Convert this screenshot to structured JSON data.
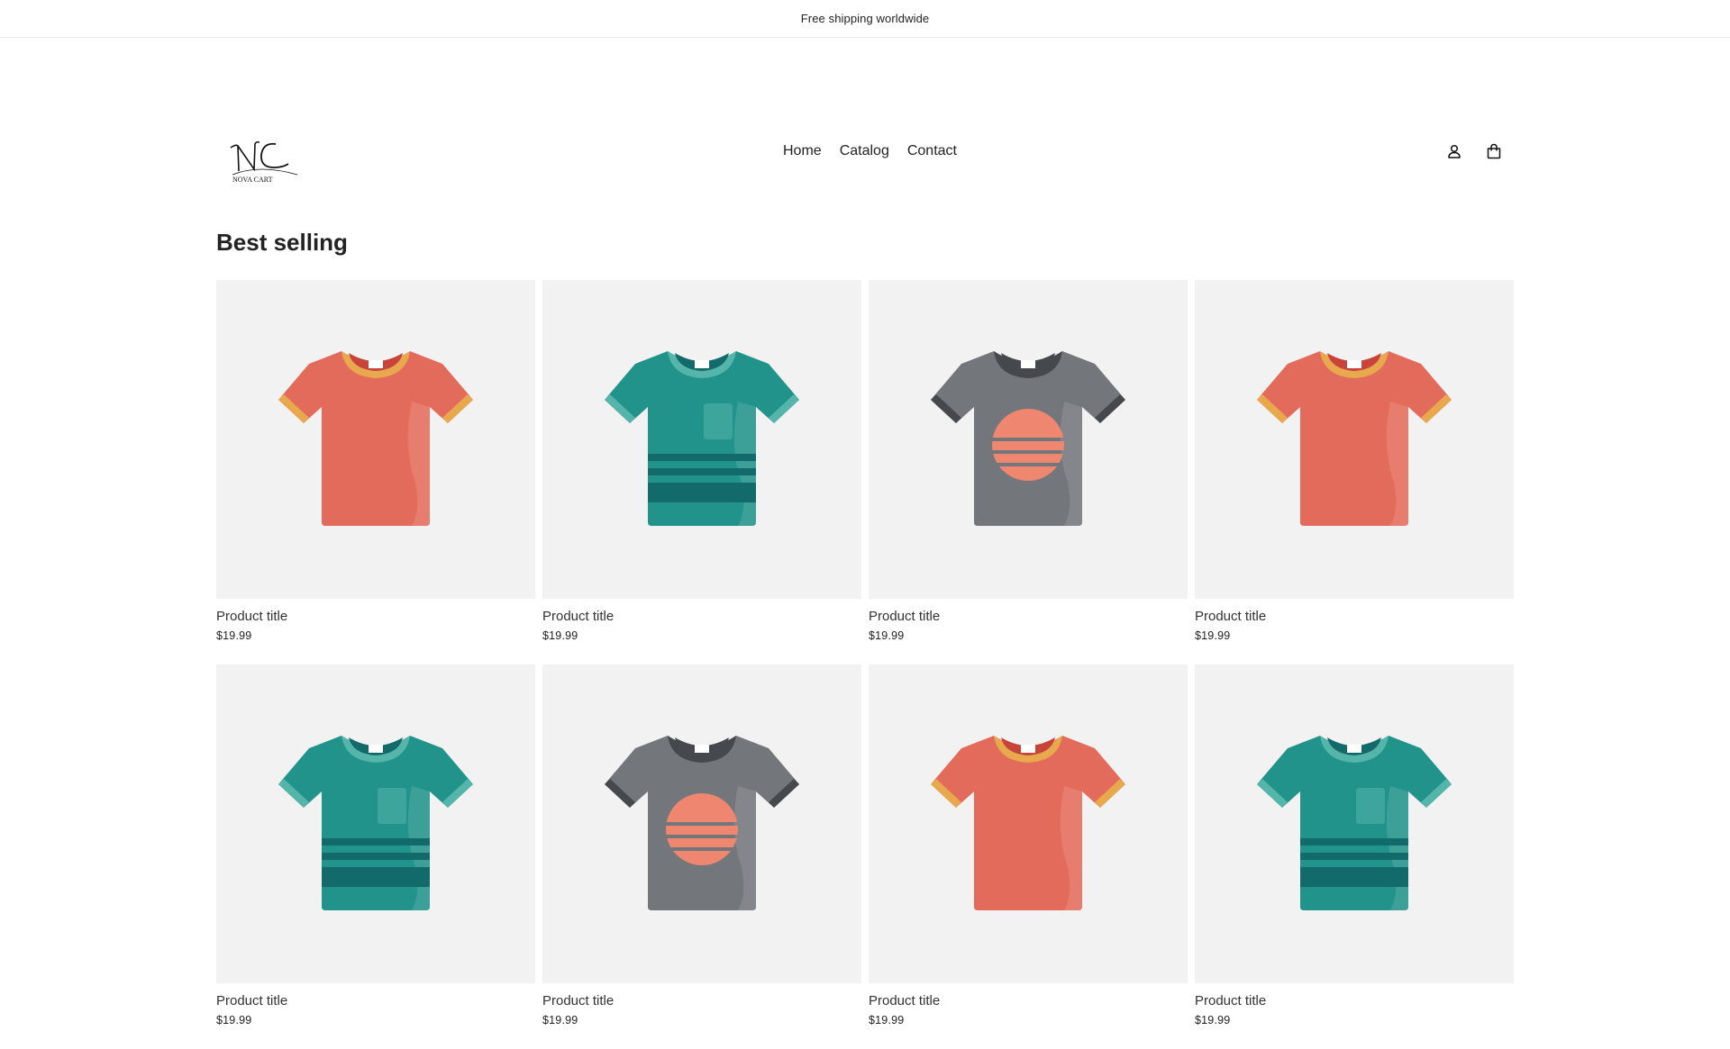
{
  "announcement": {
    "text": "Free shipping worldwide"
  },
  "header": {
    "logo_text": "NOVA CART",
    "nav": [
      {
        "label": "Home"
      },
      {
        "label": "Catalog"
      },
      {
        "label": "Contact"
      }
    ],
    "icons": [
      "account-icon",
      "cart-icon"
    ]
  },
  "section": {
    "title": "Best selling",
    "products": [
      {
        "title": "Product title",
        "price": "$19.99",
        "variant": "red"
      },
      {
        "title": "Product title",
        "price": "$19.99",
        "variant": "teal"
      },
      {
        "title": "Product title",
        "price": "$19.99",
        "variant": "gray"
      },
      {
        "title": "Product title",
        "price": "$19.99",
        "variant": "red"
      },
      {
        "title": "Product title",
        "price": "$19.99",
        "variant": "teal"
      },
      {
        "title": "Product title",
        "price": "$19.99",
        "variant": "gray"
      },
      {
        "title": "Product title",
        "price": "$19.99",
        "variant": "red"
      },
      {
        "title": "Product title",
        "price": "$19.99",
        "variant": "teal"
      }
    ]
  },
  "colors": {
    "red_body": "#e36b5b",
    "red_trim": "#e8a84e",
    "red_inner": "#c8443a",
    "teal_body": "#22938a",
    "teal_trim": "#55b5ab",
    "teal_stripe": "#126b6a",
    "gray_body": "#73767b",
    "gray_trim": "#45484c",
    "gray_sun": "#ee8670",
    "image_bg": "#f2f2f2"
  }
}
